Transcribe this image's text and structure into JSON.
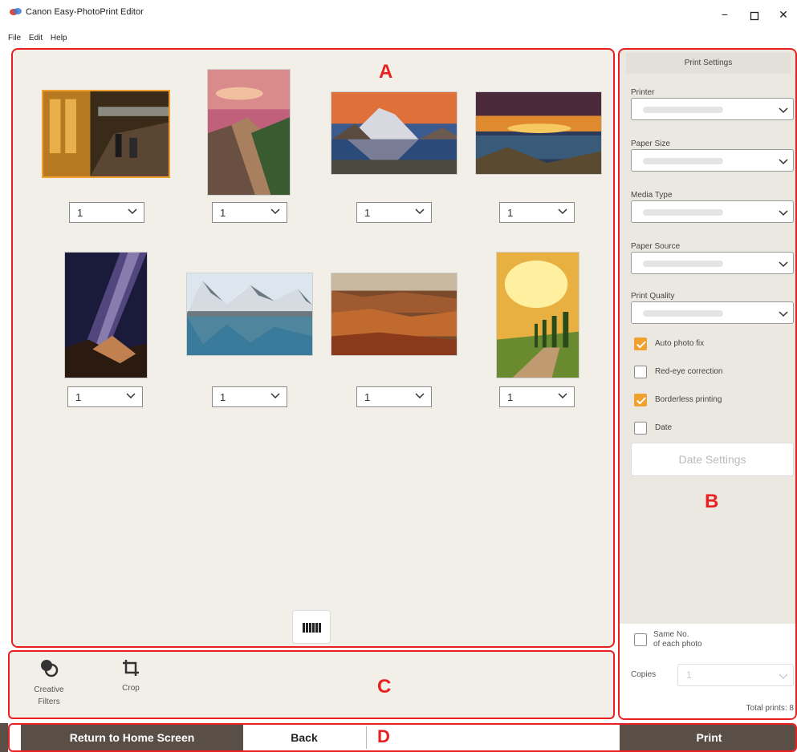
{
  "window": {
    "title": "Canon Easy-PhotoPrint Editor",
    "minimize_icon": "minimize-icon",
    "maximize_icon": "maximize-icon",
    "close_icon": "close-icon"
  },
  "menu": [
    "File",
    "Edit",
    "Help"
  ],
  "annotations": {
    "a": "A",
    "b": "B",
    "c": "C",
    "d": "D"
  },
  "photos": [
    {
      "name": "station-photo",
      "copies": "1",
      "selected": true
    },
    {
      "name": "great-wall-photo",
      "copies": "1",
      "selected": false
    },
    {
      "name": "matterhorn-photo",
      "copies": "1",
      "selected": false
    },
    {
      "name": "sunset-sea-photo",
      "copies": "1",
      "selected": false
    },
    {
      "name": "milky-way-photo",
      "copies": "1",
      "selected": false
    },
    {
      "name": "mountain-lake-photo",
      "copies": "1",
      "selected": false
    },
    {
      "name": "canyon-photo",
      "copies": "1",
      "selected": false
    },
    {
      "name": "cypress-road-photo",
      "copies": "1",
      "selected": false
    }
  ],
  "tools": {
    "creative_filters": "Creative\nFilters",
    "crop": "Crop"
  },
  "print_settings": {
    "header": "Print Settings",
    "printer_label": "Printer",
    "paper_size_label": "Paper Size",
    "media_type_label": "Media Type",
    "paper_source_label": "Paper Source",
    "print_quality_label": "Print Quality",
    "auto_photo_fix": {
      "label": "Auto photo fix",
      "checked": true
    },
    "red_eye": {
      "label": "Red-eye correction",
      "checked": false
    },
    "borderless": {
      "label": "Borderless printing",
      "checked": true
    },
    "date": {
      "label": "Date",
      "checked": false
    },
    "date_settings": "Date Settings",
    "same_no_label": "Same No.\nof each photo",
    "copies_label": "Copies",
    "copies_value": "1",
    "total_prints": "Total prints: 8"
  },
  "buttons": {
    "return_home": "Return to Home Screen",
    "back": "Back",
    "print": "Print"
  },
  "colors": {
    "accent": "#f0a030",
    "annotation": "#e8201f",
    "dark_button": "#5a4f47",
    "panel_bg": "#f2efe9"
  }
}
